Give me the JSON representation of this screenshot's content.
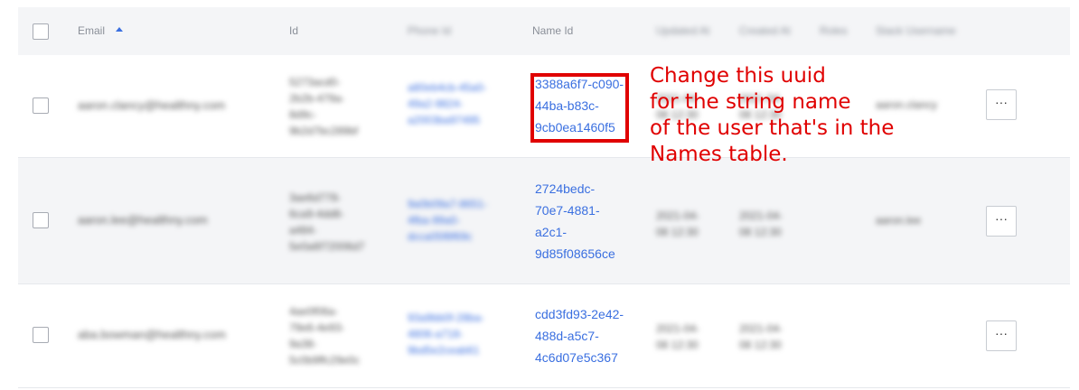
{
  "header": {
    "email": "Email",
    "id": "Id",
    "phone_id": "Phone Id",
    "name_id": "Name Id",
    "updated_at": "Updated At",
    "created_at": "Created At",
    "roles": "Roles",
    "stack_username": "Stack Username"
  },
  "rows": [
    {
      "email": "aaron.clancy@healthny.com",
      "id": [
        "5273acd0-",
        "2b2b-479a-",
        "8d9c-",
        "9b2d7bc289bf"
      ],
      "phone_id": [
        "a80eb4cb-45a0-",
        "49a2-9824-",
        "a2003ba97495"
      ],
      "name_id": [
        "3388a6f7-c090-",
        "44ba-b83c-",
        "9cb0ea1460f5"
      ],
      "updated_at": [
        "2021-04-",
        "08 12:30"
      ],
      "created_at": [
        "2021-04-",
        "08 12:30"
      ],
      "stack_username": "aaron.clancy",
      "more_label": "···"
    },
    {
      "email": "aaron.lee@healthny.com",
      "id": [
        "3ae6d778-",
        "6ca9-4dd8-",
        "a484-",
        "5e0a6f72006d7"
      ],
      "phone_id": [
        "9a0b09a7-8651-",
        "4fba-99a0-",
        "dcca05f8f69c"
      ],
      "name_id": [
        "2724bedc-",
        "70e7-4881-",
        "a2c1-",
        "9d85f08656ce"
      ],
      "updated_at": [
        "2021-04-",
        "08 12:30"
      ],
      "created_at": [
        "2021-04-",
        "08 12:30"
      ],
      "stack_username": "aaron.lee",
      "more_label": "···"
    },
    {
      "email": "aba.bowman@healthny.com",
      "id": [
        "4ae0f06a-",
        "79e6-4e93-",
        "9a38-",
        "5c0b9ffc29e0c"
      ],
      "phone_id": [
        "93a9bb0f-28ba-",
        "4806-a718-",
        "9bd5e2ceab61"
      ],
      "name_id": [
        "cdd3fd93-2e42-",
        "488d-a5c7-",
        "4c6d07e5c367"
      ],
      "updated_at": [
        "2021-04-",
        "08 12:30"
      ],
      "created_at": [
        "2021-04-",
        "08 12:30"
      ],
      "stack_username": "",
      "more_label": "···"
    }
  ],
  "annotation": {
    "lines": [
      "Change this uuid",
      "for the string name",
      "of the user that's in the",
      "Names table."
    ]
  },
  "colors": {
    "link": "#3a6fe0",
    "annotation": "#e00000",
    "header_bg": "#f4f5f7"
  }
}
